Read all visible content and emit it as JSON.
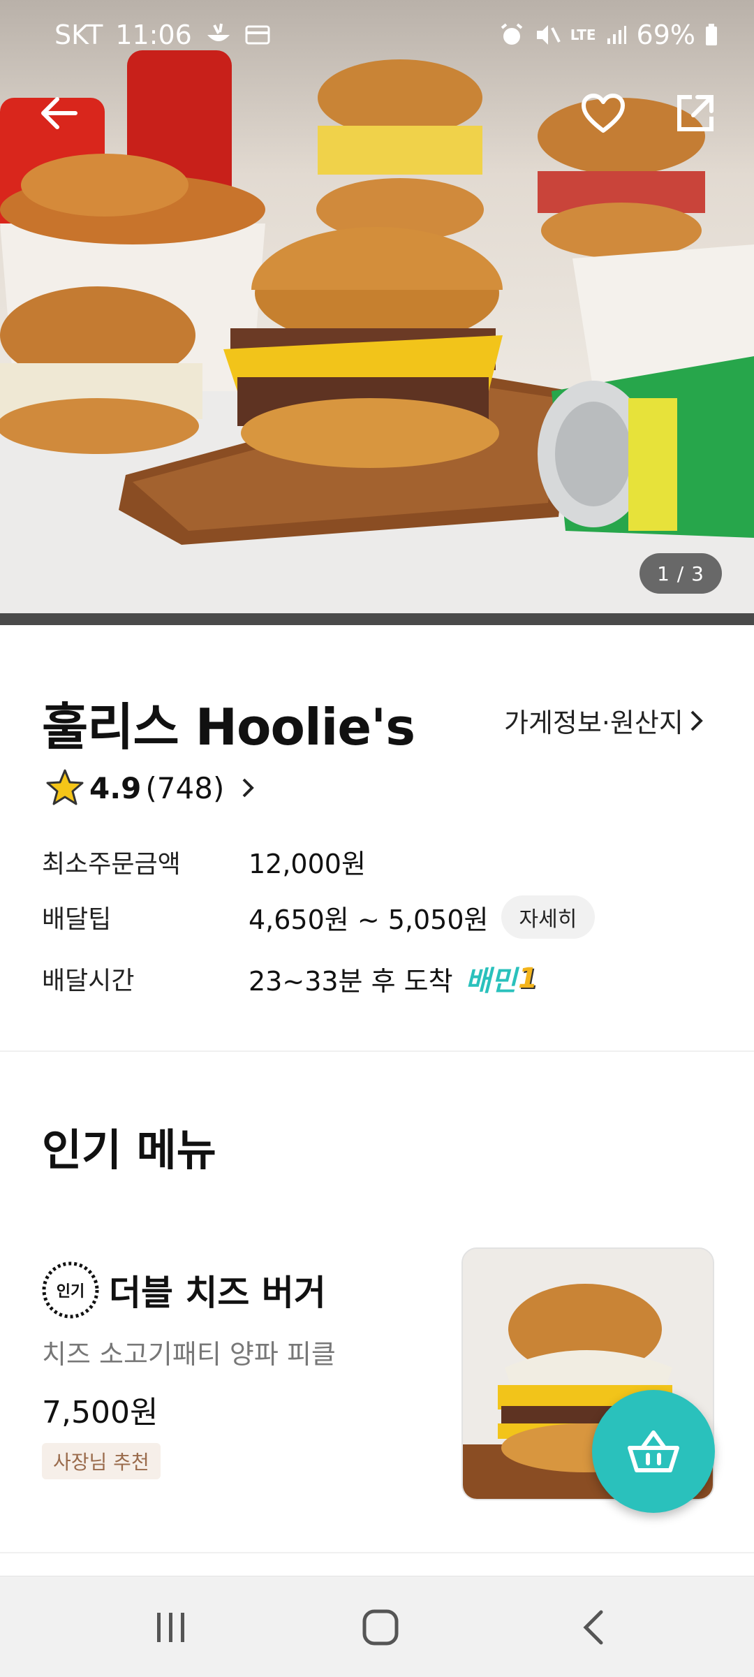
{
  "status_bar": {
    "carrier": "SKT",
    "time": "11:06",
    "network": "LTE",
    "battery": "69%"
  },
  "hero": {
    "page_indicator": "1 / 3"
  },
  "store": {
    "name": "훌리스 Hoolie's",
    "info_link": "가게정보·원산지",
    "rating": "4.9",
    "review_count": "(748)",
    "min_order_label": "최소주문금액",
    "min_order_value": "12,000원",
    "delivery_tip_label": "배달팁",
    "delivery_tip_value": "4,650원 ~ 5,050원",
    "delivery_tip_detail": "자세히",
    "delivery_time_label": "배달시간",
    "delivery_time_value": "23~33분 후 도착",
    "baemin_one": "배민",
    "baemin_one_num": "1"
  },
  "popular": {
    "title": "인기 메뉴",
    "items": [
      {
        "badge": "인기",
        "name": "더블 치즈 버거",
        "description": "치즈 소고기패티 양파 피클",
        "price": "7,500원",
        "tag": "사장님 추천"
      }
    ]
  },
  "colors": {
    "brand": "#2ac1bc",
    "tag_bg": "#f6efe9",
    "tag_text": "#9a6b4c"
  }
}
